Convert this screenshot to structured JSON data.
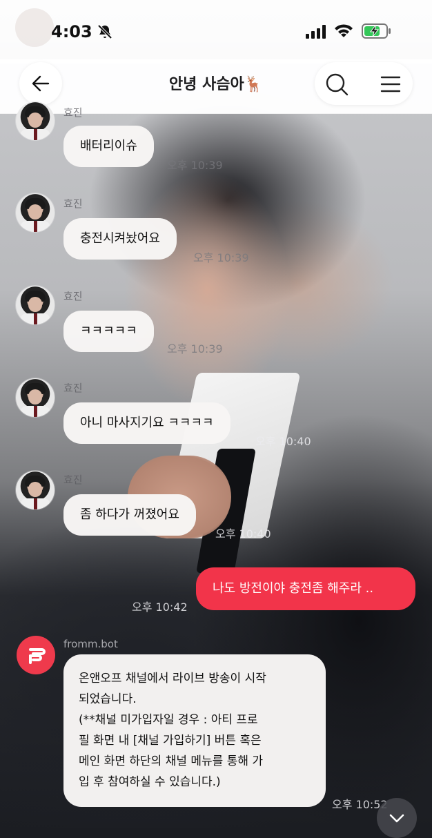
{
  "status_bar": {
    "time": "4:03"
  },
  "header": {
    "title": "안녕 사슴아🦌"
  },
  "messages": [
    {
      "sender": "효진",
      "text": "배터리이슈",
      "time": "오후 10:39"
    },
    {
      "sender": "효진",
      "text": "충전시켜놨어요",
      "time": "오후 10:39"
    },
    {
      "sender": "효진",
      "text": "ㅋㅋㅋㅋㅋ",
      "time": "오후 10:39"
    },
    {
      "sender": "효진",
      "text": "아니 마사지기요 ㅋㅋㅋㅋ",
      "time": "오후 10:40"
    },
    {
      "sender": "효진",
      "text": "좀 하다가 꺼졌어요",
      "time": "오후 10:40"
    }
  ],
  "my_message": {
    "text": "나도 방전이야 충전좀 해주라 ..",
    "time": "오후 10:42"
  },
  "bot_message": {
    "sender": "fromm.bot",
    "lines": [
      "온앤오프 채널에서 라이브 방송이 시작",
      "되었습니다.",
      "(**채널 미가입자일 경우 : 아티 프로",
      "필 화면 내 [채널 가입하기] 버튼 혹은",
      "메인 화면 하단의 채널 메뉴를 통해 가",
      "입 후 참여하실 수 있습니다.)"
    ],
    "time": "오후 10:52"
  },
  "colors": {
    "accent": "#f2344a",
    "bubble": "#f7f5f4"
  }
}
